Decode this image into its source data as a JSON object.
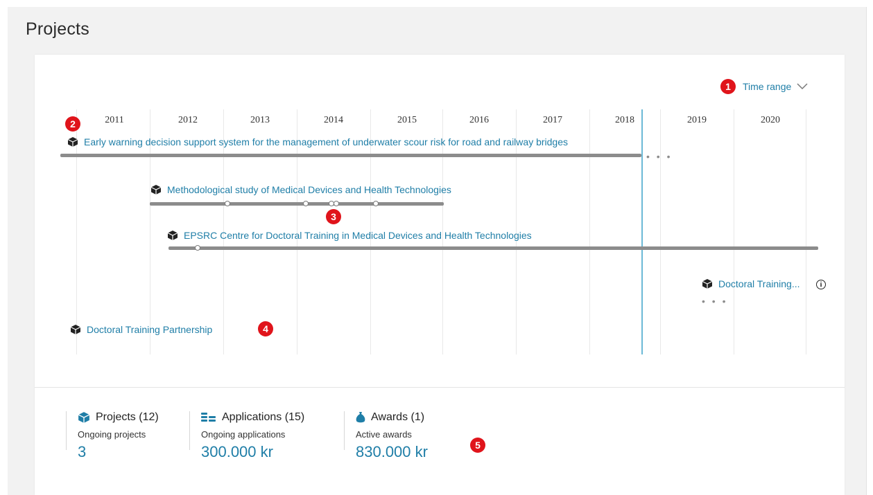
{
  "page": {
    "title": "Projects"
  },
  "timeline": {
    "time_range_label": "Time range",
    "years": [
      "2011",
      "2012",
      "2013",
      "2014",
      "2015",
      "2016",
      "2017",
      "2018",
      "2019",
      "2020"
    ],
    "more_indicator": "• • •",
    "projects": [
      {
        "title": "Early warning decision support system for the management of underwater scour risk for road and railway bridges"
      },
      {
        "title": "Methodological study of Medical Devices and Health Technologies"
      },
      {
        "title": "EPSRC Centre for Doctoral Training in Medical Devices and Health Technologies"
      },
      {
        "title": "Doctoral Training..."
      },
      {
        "title": "Doctoral Training Partnership"
      }
    ]
  },
  "annotations": [
    "1",
    "2",
    "3",
    "4",
    "5"
  ],
  "stats": [
    {
      "label": "Projects (12)",
      "sub": "Ongoing projects",
      "value": "3",
      "icon": "cube-icon"
    },
    {
      "label": "Applications (15)",
      "sub": "Ongoing applications",
      "value": "300.000 kr",
      "icon": "coins-icon"
    },
    {
      "label": "Awards (1)",
      "sub": "Active awards",
      "value": "830.000 kr",
      "icon": "money-bag-icon"
    }
  ],
  "colors": {
    "link": "#1f7ea7",
    "badge": "#e0141b",
    "now_line": "#6bb9d6",
    "bar": "#8c8c8c"
  }
}
